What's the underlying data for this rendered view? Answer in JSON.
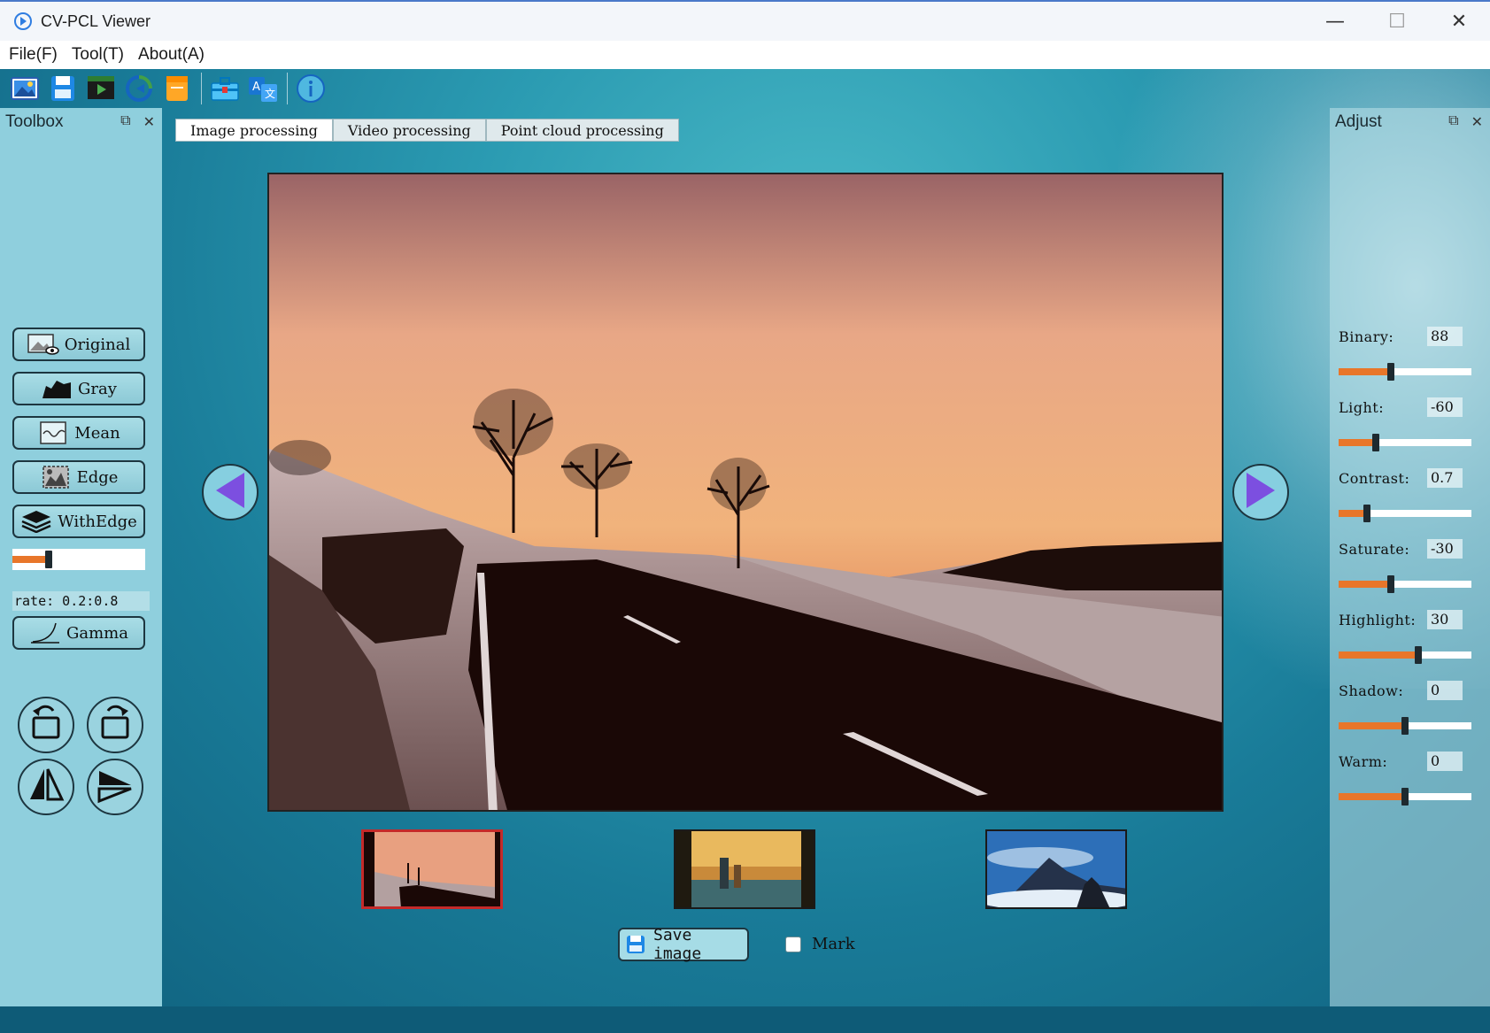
{
  "window": {
    "title": "CV-PCL Viewer",
    "minimize_glyph": "—",
    "maximize_glyph": "☐",
    "close_glyph": "✕"
  },
  "menu": [
    "File(F)",
    "Tool(T)",
    "About(A)"
  ],
  "toolbar": {
    "icons": [
      "open-image-icon",
      "save-icon",
      "video-icon",
      "refresh-icon",
      "notes-icon",
      "toolbox-icon",
      "translate-icon",
      "info-icon"
    ]
  },
  "toolbox": {
    "title": "Toolbox",
    "float_glyph": "⧉",
    "close_glyph": "✕",
    "buttons": {
      "original": "Original",
      "gray": "Gray",
      "mean": "Mean",
      "edge": "Edge",
      "withedge": "WithEdge",
      "gamma": "Gamma"
    },
    "rate_slider": {
      "value": 0.27
    },
    "rate_text": "rate: 0.2:0.8"
  },
  "tabs": [
    "Image processing",
    "Video processing",
    "Point cloud processing"
  ],
  "active_tab": "Image processing",
  "thumbnails": [
    "sunset-road",
    "hikers-river",
    "mountain-clouds"
  ],
  "selected_thumbnail": 0,
  "actions": {
    "save_label": "Save image",
    "mark_label": "Mark",
    "mark_checked": false
  },
  "adjust": {
    "title": "Adjust",
    "float_glyph": "⧉",
    "close_glyph": "✕",
    "sliders": [
      {
        "label": "Binary:",
        "value": "88",
        "position": 0.39
      },
      {
        "label": "Light:",
        "value": "-60",
        "position": 0.28
      },
      {
        "label": "Contrast:",
        "value": "0.7",
        "position": 0.21
      },
      {
        "label": "Saturate:",
        "value": "-30",
        "position": 0.39
      },
      {
        "label": "Highlight:",
        "value": "30",
        "position": 0.6
      },
      {
        "label": "Shadow:",
        "value": "0",
        "position": 0.5
      },
      {
        "label": "Warm:",
        "value": "0",
        "position": 0.5
      }
    ]
  },
  "colors": {
    "accent_orange": "#e8762a",
    "panel_bg": "#8fcfdd",
    "nav_arrow": "#7c4fe0"
  }
}
